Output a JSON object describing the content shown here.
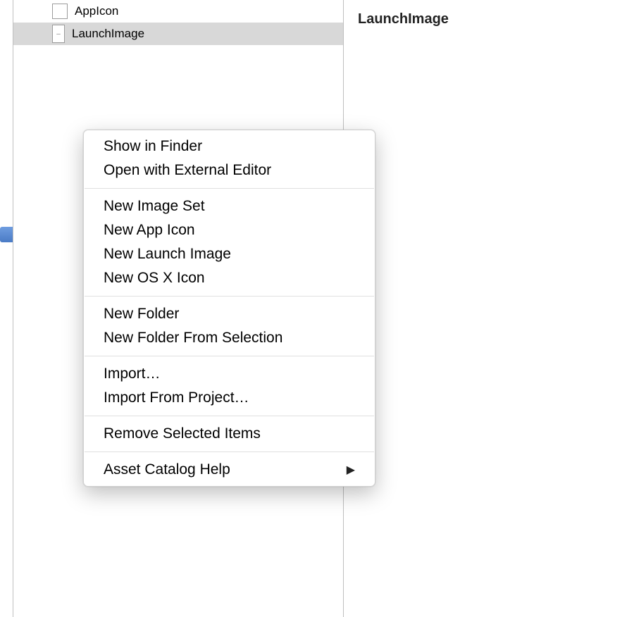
{
  "sidebar": {
    "items": [
      {
        "label": "AppIcon",
        "selected": false
      },
      {
        "label": "LaunchImage",
        "selected": true
      }
    ]
  },
  "main": {
    "title": "LaunchImage"
  },
  "context_menu": {
    "groups": [
      [
        {
          "label": "Show in Finder",
          "has_submenu": false
        },
        {
          "label": "Open with External Editor",
          "has_submenu": false
        }
      ],
      [
        {
          "label": "New Image Set",
          "has_submenu": false
        },
        {
          "label": "New App Icon",
          "has_submenu": false
        },
        {
          "label": "New Launch Image",
          "has_submenu": false
        },
        {
          "label": "New OS X Icon",
          "has_submenu": false
        }
      ],
      [
        {
          "label": "New Folder",
          "has_submenu": false
        },
        {
          "label": "New Folder From Selection",
          "has_submenu": false
        }
      ],
      [
        {
          "label": "Import…",
          "has_submenu": false
        },
        {
          "label": "Import From Project…",
          "has_submenu": false
        }
      ],
      [
        {
          "label": "Remove Selected Items",
          "has_submenu": false
        }
      ],
      [
        {
          "label": "Asset Catalog Help",
          "has_submenu": true
        }
      ]
    ]
  }
}
